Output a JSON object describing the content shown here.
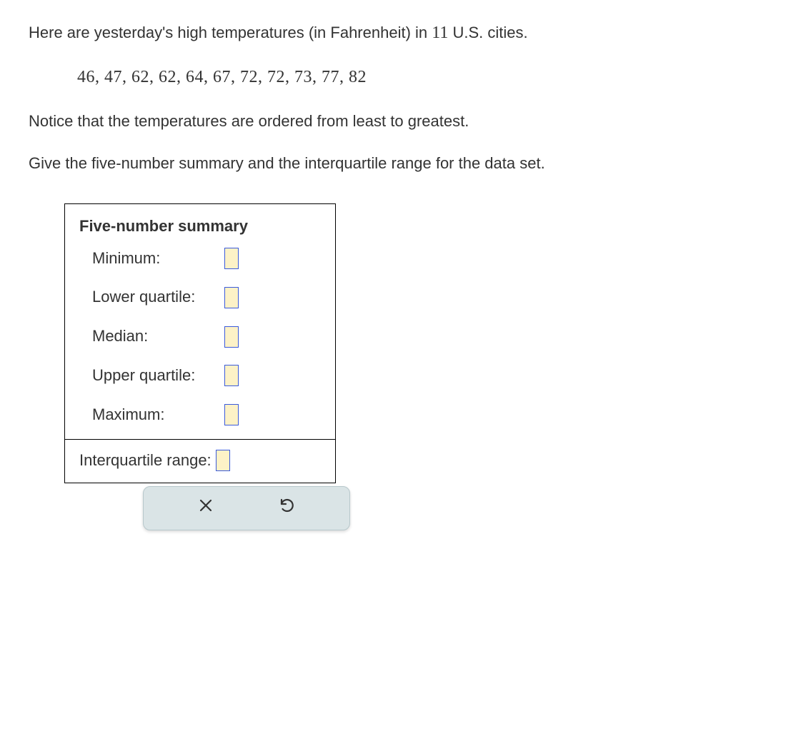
{
  "intro": {
    "prefix": "Here are yesterday's high temperatures (in Fahrenheit) in ",
    "count": "11",
    "suffix": " U.S. cities."
  },
  "data_values": "46,  47,  62,  62,  64,  67,  72,  72,  73,  77,  82",
  "notice": "Notice that the temperatures are ordered from least to greatest.",
  "prompt": "Give the five-number summary and the interquartile range for the data set.",
  "summary": {
    "heading": "Five-number summary",
    "rows": {
      "minimum": "Minimum:",
      "lower_quartile": "Lower quartile:",
      "median": "Median:",
      "upper_quartile": "Upper quartile:",
      "maximum": "Maximum:"
    },
    "iqr_label": "Interquartile range:"
  },
  "inputs": {
    "minimum": "",
    "lower_quartile": "",
    "median": "",
    "upper_quartile": "",
    "maximum": "",
    "iqr": ""
  }
}
